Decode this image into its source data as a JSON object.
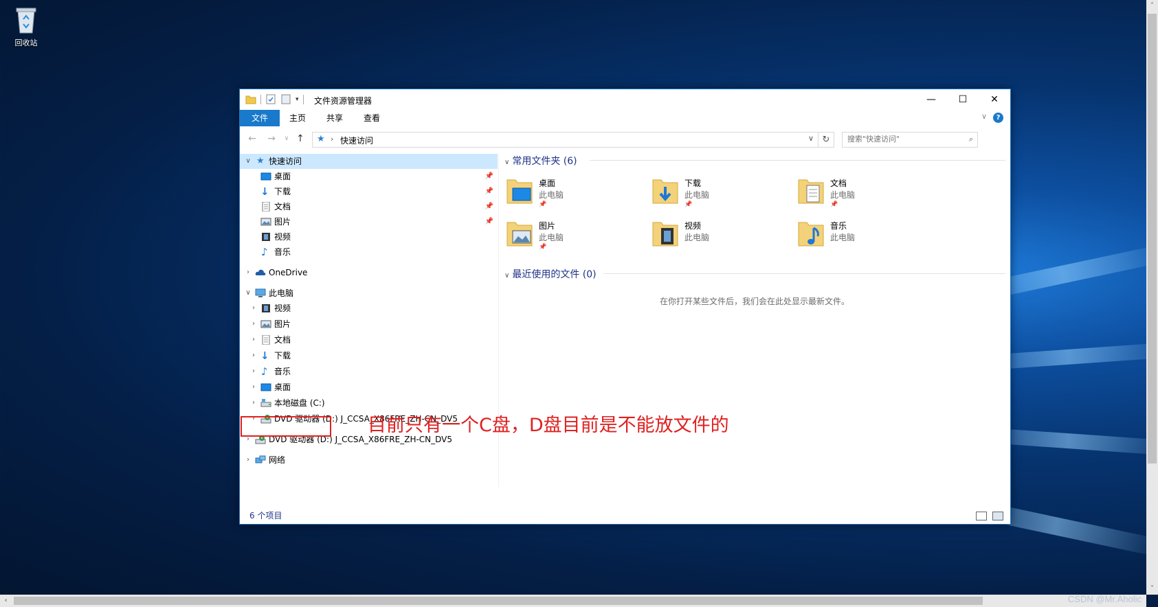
{
  "desktop": {
    "recycle_bin_label": "回收站",
    "watermark": "CSDN @Mr.Aholic"
  },
  "window": {
    "title": "文件资源管理器",
    "controls": {
      "minimize": "—",
      "maximize": "☐",
      "close": "✕"
    }
  },
  "ribbon": {
    "tabs": [
      "文件",
      "主页",
      "共享",
      "查看"
    ],
    "help_label": "?"
  },
  "nav": {
    "breadcrumb": "快速访问",
    "search_placeholder": "搜索\"快速访问\""
  },
  "tree": {
    "quick_access": "快速访问",
    "quick_items": [
      "桌面",
      "下载",
      "文档",
      "图片",
      "视频",
      "音乐"
    ],
    "onedrive": "OneDrive",
    "this_pc": "此电脑",
    "pc_items": [
      "视频",
      "图片",
      "文档",
      "下载",
      "音乐",
      "桌面"
    ],
    "local_disk": "本地磁盘 (C:)",
    "dvd_sub": "DVD 驱动器 (D:) J_CCSA_X86FRE_ZH-CN_DV5",
    "dvd_top": "DVD 驱动器 (D:) J_CCSA_X86FRE_ZH-CN_DV5",
    "network": "网络"
  },
  "content": {
    "frequent_header": "常用文件夹 (6)",
    "folders": [
      {
        "name": "桌面",
        "location": "此电脑",
        "pinned": true,
        "icon": "desktop-folder-icon"
      },
      {
        "name": "下载",
        "location": "此电脑",
        "pinned": true,
        "icon": "downloads-folder-icon"
      },
      {
        "name": "文档",
        "location": "此电脑",
        "pinned": true,
        "icon": "documents-folder-icon"
      },
      {
        "name": "图片",
        "location": "此电脑",
        "pinned": true,
        "icon": "pictures-folder-icon"
      },
      {
        "name": "视频",
        "location": "此电脑",
        "pinned": false,
        "icon": "videos-folder-icon"
      },
      {
        "name": "音乐",
        "location": "此电脑",
        "pinned": false,
        "icon": "music-folder-icon"
      }
    ],
    "recent_header": "最近使用的文件 (0)",
    "recent_empty": "在你打开某些文件后，我们会在此处显示最新文件。"
  },
  "status": {
    "item_count": "6 个项目"
  },
  "annotation": {
    "text": "目前只有一个C盘，D盘目前是不能放文件的"
  },
  "colors": {
    "accent": "#1979ca",
    "annotation": "#e02020",
    "selected": "#cce8ff"
  }
}
